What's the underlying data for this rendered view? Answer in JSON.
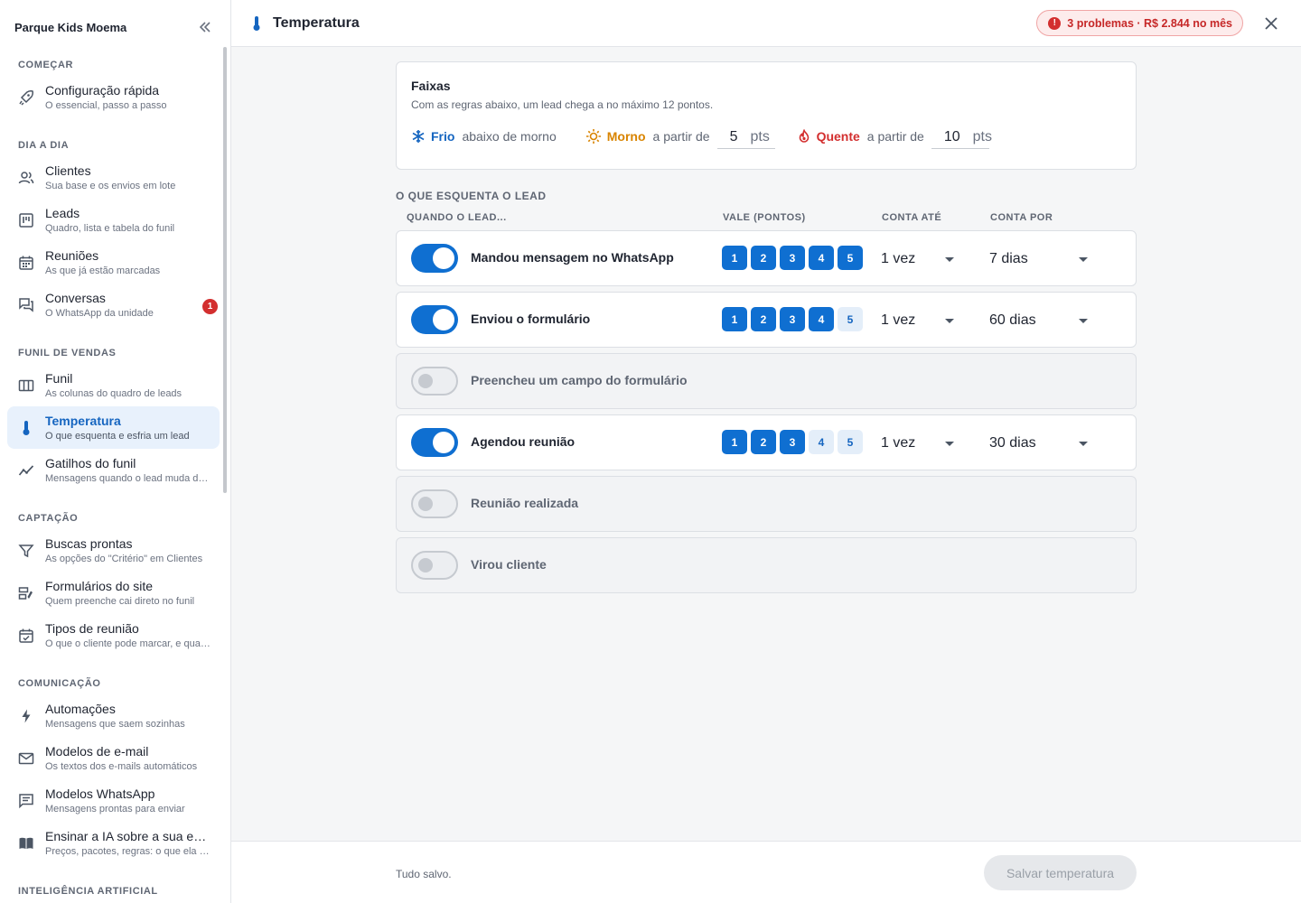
{
  "sidebar": {
    "title": "Parque Kids Moema",
    "sections": [
      {
        "label": "COMEÇAR",
        "items": [
          {
            "label": "Configuração rápida",
            "sub": "O essencial, passo a passo",
            "icon": "rocket-icon"
          }
        ]
      },
      {
        "label": "DIA A DIA",
        "items": [
          {
            "label": "Clientes",
            "sub": "Sua base e os envios em lote",
            "icon": "people-icon"
          },
          {
            "label": "Leads",
            "sub": "Quadro, lista e tabela do funil",
            "icon": "board-icon"
          },
          {
            "label": "Reuniões",
            "sub": "As que já estão marcadas",
            "icon": "calendar-icon"
          },
          {
            "label": "Conversas",
            "sub": "O WhatsApp da unidade",
            "icon": "chat-icon",
            "badge": "1"
          }
        ]
      },
      {
        "label": "FUNIL DE VENDAS",
        "items": [
          {
            "label": "Funil",
            "sub": "As colunas do quadro de leads",
            "icon": "columns-icon"
          },
          {
            "label": "Temperatura",
            "sub": "O que esquenta e esfria um lead",
            "icon": "thermometer-icon",
            "active": true
          },
          {
            "label": "Gatilhos do funil",
            "sub": "Mensagens quando o lead muda de etapa",
            "icon": "trend-icon"
          }
        ]
      },
      {
        "label": "CAPTAÇÃO",
        "items": [
          {
            "label": "Buscas prontas",
            "sub": "As opções do \"Critério\" em Clientes",
            "icon": "filter-icon"
          },
          {
            "label": "Formulários do site",
            "sub": "Quem preenche cai direto no funil",
            "icon": "form-icon"
          },
          {
            "label": "Tipos de reunião",
            "sub": "O que o cliente pode marcar, e quando",
            "icon": "event-check-icon"
          }
        ]
      },
      {
        "label": "COMUNICAÇÃO",
        "items": [
          {
            "label": "Automações",
            "sub": "Mensagens que saem sozinhas",
            "icon": "bolt-icon"
          },
          {
            "label": "Modelos de e-mail",
            "sub": "Os textos dos e-mails automáticos",
            "icon": "mail-icon"
          },
          {
            "label": "Modelos WhatsApp",
            "sub": "Mensagens prontas para enviar",
            "icon": "message-icon"
          },
          {
            "label": "Ensinar a IA sobre a sua empresa",
            "sub": "Preços, pacotes, regras: o que ela precisa saber",
            "icon": "book-icon"
          }
        ]
      },
      {
        "label": "INTELIGÊNCIA ARTIFICIAL",
        "items": []
      }
    ]
  },
  "header": {
    "title": "Temperatura",
    "problems": "3 problemas · R$ 2.844 no mês"
  },
  "faixas": {
    "title": "Faixas",
    "description": "Com as regras abaixo, um lead chega a no máximo 12 pontos.",
    "frio": {
      "name": "Frio",
      "text": "abaixo de morno"
    },
    "morno": {
      "name": "Morno",
      "text": "a partir de",
      "value": "5",
      "unit": "pts"
    },
    "quente": {
      "name": "Quente",
      "text": "a partir de",
      "value": "10",
      "unit": "pts"
    }
  },
  "rules_section": {
    "heading": "O QUE ESQUENTA O LEAD",
    "col_when": "QUANDO O LEAD...",
    "col_value": "VALE (PONTOS)",
    "col_count_until": "CONTA ATÉ",
    "col_count_for": "CONTA POR"
  },
  "rules": [
    {
      "label": "Mandou mensagem no WhatsApp",
      "enabled": true,
      "points": 5,
      "count_until": "1 vez",
      "count_for": "7 dias"
    },
    {
      "label": "Enviou o formulário",
      "enabled": true,
      "points": 4,
      "count_until": "1 vez",
      "count_for": "60 dias"
    },
    {
      "label": "Preencheu um campo do formulário",
      "enabled": false
    },
    {
      "label": "Agendou reunião",
      "enabled": true,
      "points": 3,
      "count_until": "1 vez",
      "count_for": "30 dias"
    },
    {
      "label": "Reunião realizada",
      "enabled": false
    },
    {
      "label": "Virou cliente",
      "enabled": false
    }
  ],
  "point_options": [
    "1",
    "2",
    "3",
    "4",
    "5"
  ],
  "footer": {
    "status": "Tudo salvo.",
    "save_label": "Salvar temperatura"
  },
  "colors": {
    "accent": "#0f6fd1",
    "frio": "#1565c0",
    "morno": "#d98400",
    "quente": "#d32f2f"
  }
}
